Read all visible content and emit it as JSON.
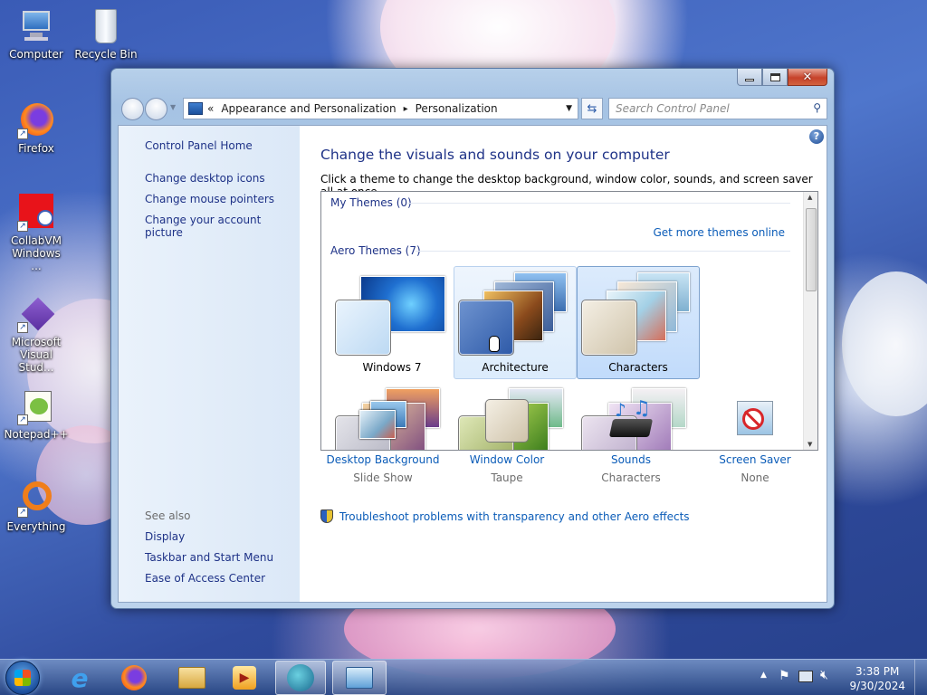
{
  "desktop": {
    "icons": [
      {
        "label": "Computer",
        "icon": "computer-icon"
      },
      {
        "label": "Recycle Bin",
        "icon": "recycle-bin-icon"
      },
      {
        "label": "Firefox",
        "icon": "firefox-icon"
      },
      {
        "label": "CollabVM Windows ...",
        "icon": "collabvm-icon"
      },
      {
        "label": "Microsoft Visual Stud...",
        "icon": "visual-studio-icon"
      },
      {
        "label": "Notepad++",
        "icon": "notepadpp-icon"
      },
      {
        "label": "Everything",
        "icon": "everything-icon"
      }
    ]
  },
  "window": {
    "breadcrumb": {
      "root": "«",
      "part1": "Appearance and Personalization",
      "sep": "▸",
      "part2": "Personalization"
    },
    "search_placeholder": "Search Control Panel",
    "left": {
      "home": "Control Panel Home",
      "links": [
        "Change desktop icons",
        "Change mouse pointers",
        "Change your account picture"
      ],
      "see_also": "See also",
      "see_also_links": [
        "Display",
        "Taskbar and Start Menu",
        "Ease of Access Center"
      ]
    },
    "title": "Change the visuals and sounds on your computer",
    "subtitle": "Click a theme to change the desktop background, window color, sounds, and screen saver all at once.",
    "my_themes": "My Themes (0)",
    "get_more": "Get more themes online",
    "aero_themes": "Aero Themes (7)",
    "themes": [
      {
        "name": "Windows 7",
        "state": "normal"
      },
      {
        "name": "Architecture",
        "state": "hover"
      },
      {
        "name": "Characters",
        "state": "selected"
      }
    ],
    "options": [
      {
        "label": "Desktop Background",
        "value": "Slide Show",
        "icon": "desktop-background-icon"
      },
      {
        "label": "Window Color",
        "value": "Taupe",
        "icon": "window-color-icon"
      },
      {
        "label": "Sounds",
        "value": "Characters",
        "icon": "sounds-icon"
      },
      {
        "label": "Screen Saver",
        "value": "None",
        "icon": "screen-saver-icon"
      }
    ],
    "troubleshoot": "Troubleshoot problems with transparency and other Aero effects"
  },
  "taskbar": {
    "time": "3:38 PM",
    "date": "9/30/2024",
    "pinned": [
      "internet-explorer-icon",
      "firefox-icon",
      "file-explorer-icon",
      "media-player-icon",
      "collabvm-icon",
      "control-panel-icon"
    ]
  },
  "colors": {
    "link": "#1e3287",
    "accent_link": "#0b5cb8",
    "selected_tile": "#c1dbfb"
  }
}
